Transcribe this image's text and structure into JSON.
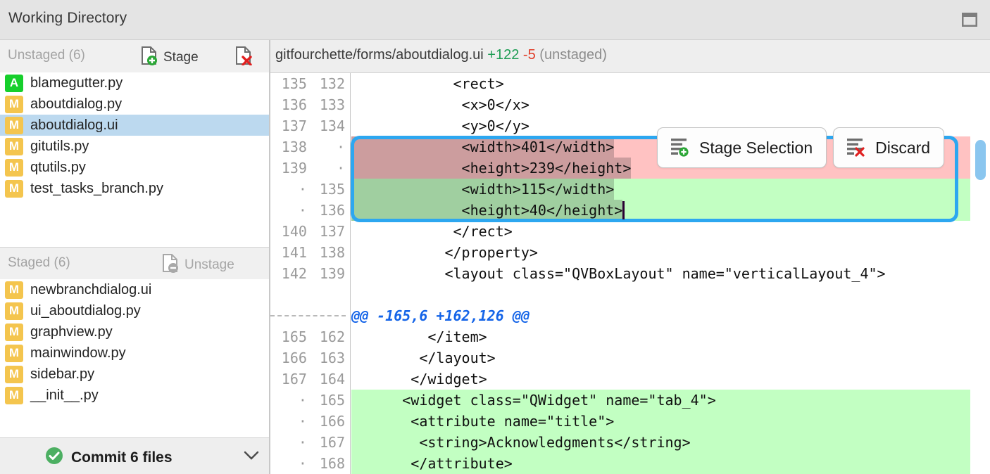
{
  "window": {
    "title": "Working Directory",
    "restore_icon": "window-restore-icon"
  },
  "sidebar": {
    "unstaged": {
      "title": "Unstaged (6)",
      "stage_button": "Stage",
      "stage_icon": "file-add-icon",
      "discard_icon": "file-discard-icon",
      "files": [
        {
          "status": "A",
          "name": "blamegutter.py",
          "selected": false
        },
        {
          "status": "M",
          "name": "aboutdialog.py",
          "selected": false
        },
        {
          "status": "M",
          "name": "aboutdialog.ui",
          "selected": true
        },
        {
          "status": "M",
          "name": "gitutils.py",
          "selected": false
        },
        {
          "status": "M",
          "name": "qtutils.py",
          "selected": false
        },
        {
          "status": "M",
          "name": "test_tasks_branch.py",
          "selected": false
        }
      ]
    },
    "staged": {
      "title": "Staged (6)",
      "unstage_button": "Unstage",
      "unstage_icon": "file-remove-icon",
      "files": [
        {
          "status": "M",
          "name": "newbranchdialog.ui",
          "selected": false
        },
        {
          "status": "M",
          "name": "ui_aboutdialog.py",
          "selected": false
        },
        {
          "status": "M",
          "name": "graphview.py",
          "selected": false
        },
        {
          "status": "M",
          "name": "mainwindow.py",
          "selected": false
        },
        {
          "status": "M",
          "name": "sidebar.py",
          "selected": false
        },
        {
          "status": "M",
          "name": "__init__.py",
          "selected": false
        }
      ]
    },
    "commit": {
      "label": "Commit 6 files",
      "check_icon": "check-circle-icon",
      "caret_icon": "chevron-down-icon"
    }
  },
  "diff": {
    "header": {
      "path": "gitfourchette/forms/aboutdialog.ui",
      "additions": "+122",
      "deletions": "-5",
      "state": "(unstaged)"
    },
    "actions": [
      {
        "label": "Stage Selection",
        "icon": "lines-add-icon"
      },
      {
        "label": "Discard",
        "icon": "lines-discard-icon"
      }
    ],
    "lines": [
      {
        "old": "135",
        "new": "132",
        "type": "context",
        "text": "            <rect>"
      },
      {
        "old": "136",
        "new": "133",
        "type": "context",
        "text": "             <x>0</x>"
      },
      {
        "old": "137",
        "new": "134",
        "type": "context",
        "text": "             <y>0</y>"
      },
      {
        "old": "138",
        "new": "·",
        "type": "del",
        "text": "             <width>401</width>",
        "selected": true
      },
      {
        "old": "139",
        "new": "·",
        "type": "del",
        "text": "             <height>239</height>",
        "selected": true
      },
      {
        "old": "·",
        "new": "135",
        "type": "add",
        "text": "             <width>115</width>",
        "selected": true
      },
      {
        "old": "·",
        "new": "136",
        "type": "add",
        "text": "             <height>40</height>",
        "selected": true
      },
      {
        "old": "140",
        "new": "137",
        "type": "context",
        "text": "            </rect>"
      },
      {
        "old": "141",
        "new": "138",
        "type": "context",
        "text": "           </property>"
      },
      {
        "old": "142",
        "new": "139",
        "type": "context",
        "text": "           <layout class=\"QVBoxLayout\" name=\"verticalLayout_4\">"
      },
      {
        "old": "",
        "new": "",
        "type": "hunk",
        "text": "@@ -165,6 +162,126 @@"
      },
      {
        "old": "165",
        "new": "162",
        "type": "context",
        "text": "         </item>"
      },
      {
        "old": "166",
        "new": "163",
        "type": "context",
        "text": "        </layout>"
      },
      {
        "old": "167",
        "new": "164",
        "type": "context",
        "text": "       </widget>"
      },
      {
        "old": "·",
        "new": "165",
        "type": "add",
        "text": "      <widget class=\"QWidget\" name=\"tab_4\">"
      },
      {
        "old": "·",
        "new": "166",
        "type": "add",
        "text": "       <attribute name=\"title\">"
      },
      {
        "old": "·",
        "new": "167",
        "type": "add",
        "text": "        <string>Acknowledgments</string>"
      },
      {
        "old": "·",
        "new": "168",
        "type": "add",
        "text": "       </attribute>"
      }
    ]
  },
  "colors": {
    "add_bg": "#c2ffc2",
    "del_bg": "#ffc2c2",
    "add_sel_bg": "#a0cfa0",
    "del_sel_bg": "#cc9d9e",
    "selection_frame": "#2da7f0",
    "row_selected": "#bcd9ef",
    "status_added": "#16cf2c",
    "status_modified": "#f4c54e",
    "additions_text": "#1f9d55",
    "deletions_text": "#e03a25",
    "hunk_text": "#1464e8",
    "scrollbar_thumb": "#8ac6ef"
  }
}
